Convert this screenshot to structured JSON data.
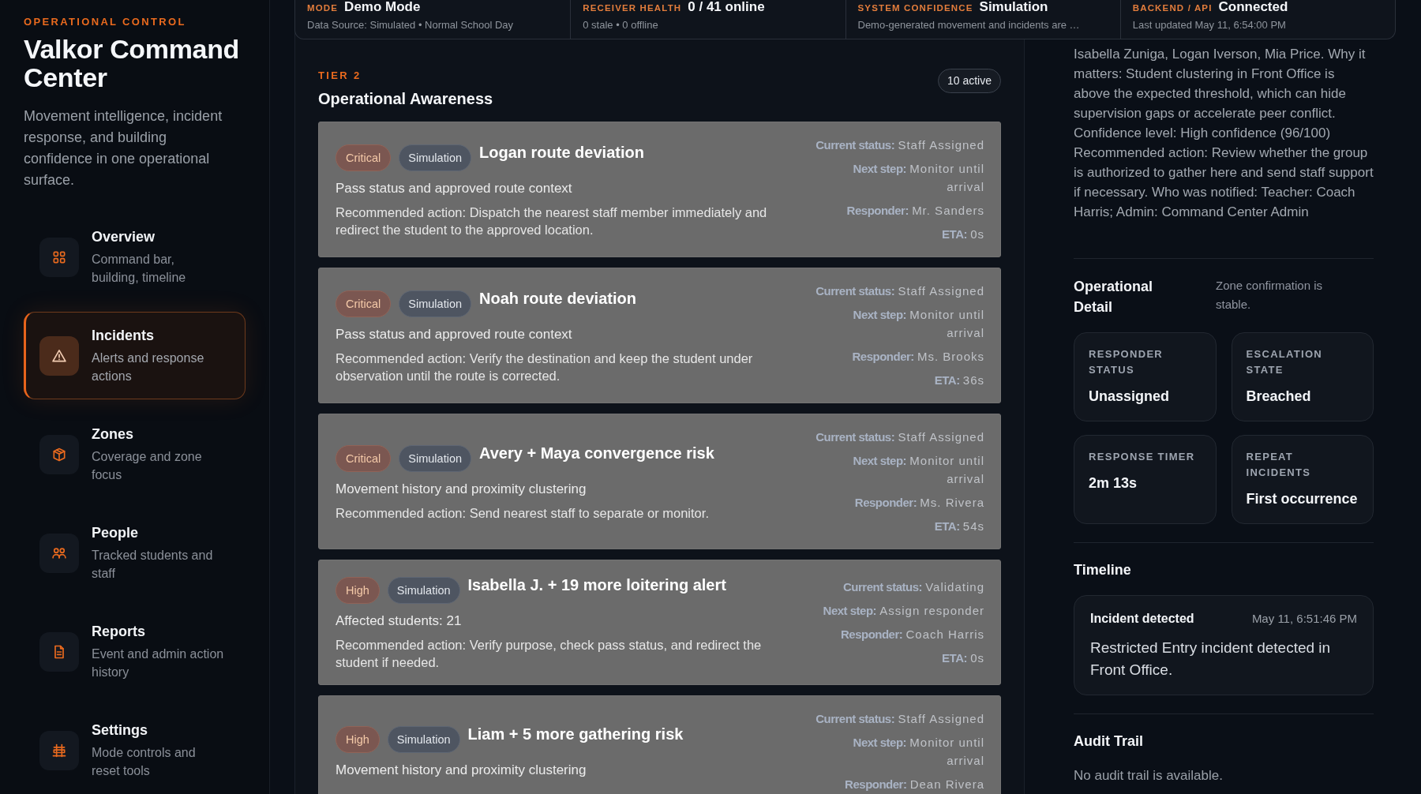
{
  "sidebar": {
    "eyebrow": "OPERATIONAL CONTROL",
    "title": "Valkor Command Center",
    "description": "Movement intelligence, incident response, and building confidence in one operational surface.",
    "nav": [
      {
        "label": "Overview",
        "description": "Command bar, building, timeline",
        "selected": false
      },
      {
        "label": "Incidents",
        "description": "Alerts and response actions",
        "selected": true
      },
      {
        "label": "Zones",
        "description": "Coverage and zone focus",
        "selected": false
      },
      {
        "label": "People",
        "description": "Tracked students and staff",
        "selected": false
      },
      {
        "label": "Reports",
        "description": "Event and admin action history",
        "selected": false
      },
      {
        "label": "Settings",
        "description": "Mode controls and reset tools",
        "selected": false
      }
    ]
  },
  "status_bar": [
    {
      "label": "MODE",
      "value": "Demo Mode",
      "detail": "Data Source: Simulated • Normal School Day"
    },
    {
      "label": "RECEIVER HEALTH",
      "value": "0 / 41 online",
      "detail": "0 stale • 0 offline"
    },
    {
      "label": "SYSTEM CONFIDENCE",
      "value": "Simulation",
      "detail": "Demo-generated movement and incidents are …"
    },
    {
      "label": "BACKEND / API",
      "value": "Connected",
      "detail": "Last updated May 11, 6:54:00 PM"
    }
  ],
  "incidents": {
    "eyebrow": "TIER 2",
    "title": "Operational Awareness",
    "count": "10 active",
    "items": [
      {
        "severity": "Critical",
        "source": "Simulation",
        "title": "Logan route deviation",
        "context": "Pass status and approved route context",
        "action": "Recommended action: Dispatch the nearest staff member immediately and redirect the student to the approved location.",
        "fields": [
          {
            "label": "Current status:",
            "value": "Staff Assigned"
          },
          {
            "label": "Next step:",
            "value": "Monitor until arrival"
          },
          {
            "label": "Responder:",
            "value": "Mr. Sanders"
          },
          {
            "label": "ETA:",
            "value": "0s"
          }
        ]
      },
      {
        "severity": "Critical",
        "source": "Simulation",
        "title": "Noah route deviation",
        "context": "Pass status and approved route context",
        "action": "Recommended action: Verify the destination and keep the student under observation until the route is corrected.",
        "fields": [
          {
            "label": "Current status:",
            "value": "Staff Assigned"
          },
          {
            "label": "Next step:",
            "value": "Monitor until arrival"
          },
          {
            "label": "Responder:",
            "value": "Ms. Brooks"
          },
          {
            "label": "ETA:",
            "value": "36s"
          }
        ]
      },
      {
        "severity": "Critical",
        "source": "Simulation",
        "title": "Avery + Maya convergence risk",
        "context": "Movement history and proximity clustering",
        "action": "Recommended action: Send nearest staff to separate or monitor.",
        "fields": [
          {
            "label": "Current status:",
            "value": "Staff Assigned"
          },
          {
            "label": "Next step:",
            "value": "Monitor until arrival"
          },
          {
            "label": "Responder:",
            "value": "Ms. Rivera"
          },
          {
            "label": "ETA:",
            "value": "54s"
          }
        ]
      },
      {
        "severity": "High",
        "source": "Simulation",
        "title": "Isabella J. + 19 more loitering alert",
        "context": "Affected students: 21",
        "action": "Recommended action: Verify purpose, check pass status, and redirect the student if needed.",
        "fields": [
          {
            "label": "Current status:",
            "value": "Validating"
          },
          {
            "label": "Next step:",
            "value": "Assign responder"
          },
          {
            "label": "Responder:",
            "value": "Coach Harris"
          },
          {
            "label": "ETA:",
            "value": "0s"
          }
        ]
      },
      {
        "severity": "High",
        "source": "Simulation",
        "title": "Liam + 5 more gathering risk",
        "context": "Movement history and proximity clustering",
        "fields": [
          {
            "label": "Current status:",
            "value": "Staff Assigned"
          },
          {
            "label": "Next step:",
            "value": "Monitor until arrival"
          },
          {
            "label": "Responder:",
            "value": "Dean Rivera"
          }
        ]
      }
    ]
  },
  "detail": {
    "summary": "Isabella Zuniga, Logan Iverson, Mia Price. Why it matters: Student clustering in Front Office is above the expected threshold, which can hide supervision gaps or accelerate peer conflict. Confidence level: High confidence (96/100) Recommended action: Review whether the group is authorized to gather here and send staff support if necessary. Who was notified: Teacher: Coach Harris; Admin: Command Center Admin",
    "operational_detail": {
      "title": "Operational Detail",
      "note": "Zone confirmation is stable.",
      "stats": [
        {
          "label": "RESPONDER STATUS",
          "value": "Unassigned"
        },
        {
          "label": "ESCALATION STATE",
          "value": "Breached"
        },
        {
          "label": "RESPONSE TIMER",
          "value": "2m 13s"
        },
        {
          "label": "REPEAT INCIDENTS",
          "value": "First occurrence"
        }
      ]
    },
    "timeline": {
      "title": "Timeline",
      "entries": [
        {
          "title": "Incident detected",
          "time": "May 11, 6:51:46 PM",
          "description": "Restricted Entry incident detected in Front Office."
        }
      ]
    },
    "audit_trail": {
      "title": "Audit Trail",
      "empty_text": "No audit trail is available."
    }
  }
}
